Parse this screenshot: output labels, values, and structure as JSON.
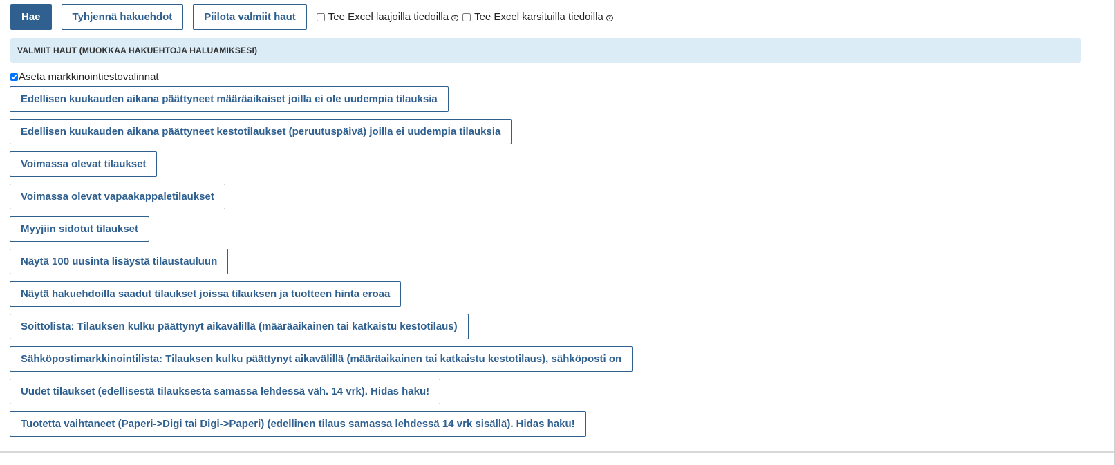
{
  "toolbar": {
    "search_label": "Hae",
    "clear_label": "Tyhjennä hakuehdot",
    "hide_label": "Piilota valmiit haut",
    "excel_full_label": "Tee Excel laajoilla tiedoilla",
    "excel_trimmed_label": "Tee Excel karsituilla tiedoilla",
    "help_glyph": "?",
    "excel_full_checked": false,
    "excel_trimmed_checked": false
  },
  "section": {
    "title": "VALMIIT HAUT (MUOKKAA HAKUEHTOJA HALUAMIKSESI)"
  },
  "marketing": {
    "label": "Aseta markkinointiestovalinnat",
    "checked": true
  },
  "saved_searches": [
    "Edellisen kuukauden aikana päättyneet määräaikaiset joilla ei ole uudempia tilauksia",
    "Edellisen kuukauden aikana päättyneet kestotilaukset (peruutuspäivä) joilla ei uudempia tilauksia",
    "Voimassa olevat tilaukset",
    "Voimassa olevat vapaakappaletilaukset",
    "Myyjiin sidotut tilaukset",
    "Näytä 100 uusinta lisäystä tilaustauluun",
    "Näytä hakuehdoilla saadut tilaukset joissa tilauksen ja tuotteen hinta eroaa",
    "Soittolista: Tilauksen kulku päättynyt aikavälillä (määräaikainen tai katkaistu kestotilaus)",
    "Sähköpostimarkkinointilista: Tilauksen kulku päättynyt aikavälillä (määräaikainen tai katkaistu kestotilaus), sähköposti on",
    "Uudet tilaukset (edellisestä tilauksesta samassa lehdessä väh. 14 vrk). Hidas haku!",
    "Tuotetta vaihtaneet (Paperi->Digi tai Digi->Paperi) (edellinen tilaus samassa lehdessä 14 vrk sisällä). Hidas haku!"
  ],
  "colors": {
    "accent": "#2f6090",
    "header_bg": "#dcecf7"
  }
}
